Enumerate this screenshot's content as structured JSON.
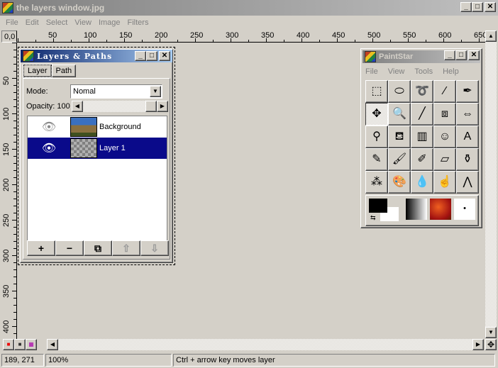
{
  "window": {
    "title": "the layers window.jpg",
    "controls": [
      "minimize",
      "maximize",
      "close"
    ]
  },
  "menu": [
    "File",
    "Edit",
    "Select",
    "View",
    "Image",
    "Filters"
  ],
  "rulers": {
    "origin": "0,0",
    "horizontal": [
      "50",
      "100",
      "150",
      "200",
      "250",
      "300",
      "350",
      "400",
      "450",
      "500",
      "550",
      "600",
      "650"
    ],
    "vertical": [
      "50",
      "100",
      "150",
      "200",
      "250",
      "300",
      "350",
      "400"
    ]
  },
  "layers_panel": {
    "title": "Layers & Paths",
    "tabs": [
      "Layer",
      "Path"
    ],
    "active_tab": "Layer",
    "mode_label": "Mode:",
    "mode_value": "Nomal",
    "opacity_label": "Opacity: 100",
    "opacity_value": 100,
    "layers": [
      {
        "name": "Background",
        "visible": true,
        "selected": false
      },
      {
        "name": "Layer 1",
        "visible": true,
        "selected": true
      }
    ],
    "buttons": [
      {
        "name": "add-layer",
        "glyph": "+"
      },
      {
        "name": "delete-layer",
        "glyph": "−"
      },
      {
        "name": "duplicate-layer",
        "glyph": "⧉"
      },
      {
        "name": "move-up",
        "glyph": "⇧"
      },
      {
        "name": "move-down",
        "glyph": "⇩"
      }
    ]
  },
  "paint_panel": {
    "title": "PaintStar",
    "menu": [
      "File",
      "View",
      "Tools",
      "Help"
    ],
    "tools": [
      {
        "name": "rect-select",
        "glyph": "⬚"
      },
      {
        "name": "ellipse-select",
        "glyph": "⬭"
      },
      {
        "name": "lasso",
        "glyph": "➰"
      },
      {
        "name": "magic-wand",
        "glyph": "⁄"
      },
      {
        "name": "pen",
        "glyph": "✒"
      },
      {
        "name": "move",
        "glyph": "✥",
        "active": true
      },
      {
        "name": "zoom",
        "glyph": "🔍"
      },
      {
        "name": "brush-line",
        "glyph": "╱"
      },
      {
        "name": "crop",
        "glyph": "⧈"
      },
      {
        "name": "flip",
        "glyph": "⇔"
      },
      {
        "name": "eyedropper",
        "glyph": "⚲"
      },
      {
        "name": "fill",
        "glyph": "⛾"
      },
      {
        "name": "gradient",
        "glyph": "▥"
      },
      {
        "name": "clone",
        "glyph": "☺"
      },
      {
        "name": "text",
        "glyph": "A"
      },
      {
        "name": "pencil",
        "glyph": "✎"
      },
      {
        "name": "paintbrush",
        "glyph": "🖌"
      },
      {
        "name": "airbrush",
        "glyph": "✐"
      },
      {
        "name": "eraser",
        "glyph": "▱"
      },
      {
        "name": "stamp",
        "glyph": "⚱"
      },
      {
        "name": "spray",
        "glyph": "⁂"
      },
      {
        "name": "palette",
        "glyph": "🎨"
      },
      {
        "name": "blur",
        "glyph": "💧"
      },
      {
        "name": "smudge",
        "glyph": "☝"
      },
      {
        "name": "compass",
        "glyph": "⋀"
      }
    ],
    "foreground": "#000000",
    "background": "#ffffff"
  },
  "status": {
    "coords": "189, 271",
    "zoom": "100%",
    "hint": "Ctrl + arrow key moves layer"
  }
}
